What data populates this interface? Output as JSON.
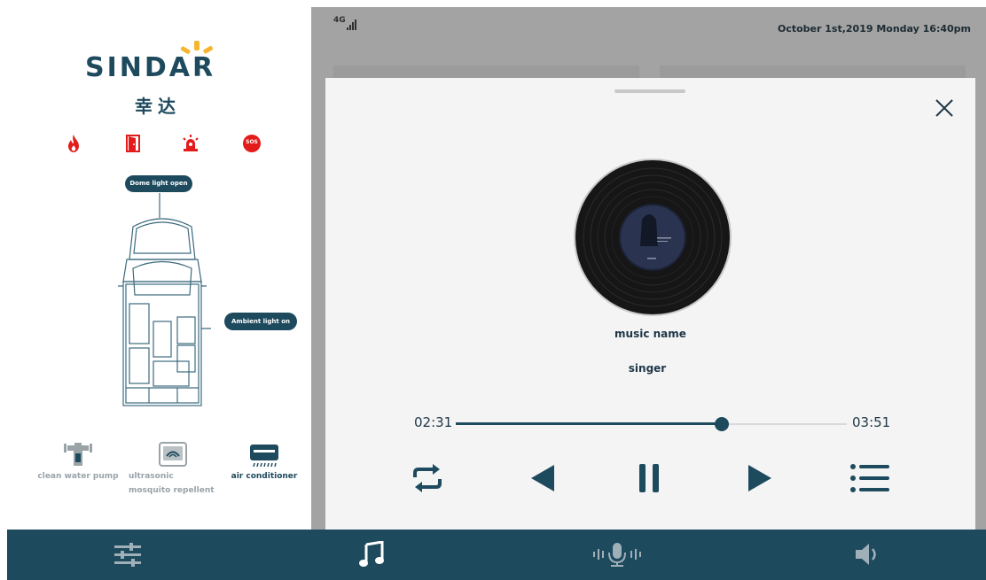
{
  "sidebar": {
    "logo": {
      "brand": "SINDAR",
      "brand_cn": "幸达"
    },
    "alerts": [
      {
        "name": "fire-alert",
        "icon": "fire-icon",
        "color": "#e31b1b"
      },
      {
        "name": "door-alert",
        "icon": "door-icon",
        "color": "#e31b1b"
      },
      {
        "name": "alarm-alert",
        "icon": "siren-icon",
        "color": "#e31b1b"
      },
      {
        "name": "sos-alert",
        "icon": "sos-icon",
        "label": "SOS",
        "color": "#e31b1b"
      }
    ],
    "vehicle": {
      "dome_light_label": "Dome light open",
      "ambient_light_label": "Ambient light on"
    },
    "devices": [
      {
        "label": "clean water pump",
        "icon": "water-pump-icon",
        "active": false
      },
      {
        "label": "ultrasonic  mosquito repellent",
        "icon": "mosquito-repellent-icon",
        "active": false
      },
      {
        "label": "air conditioner",
        "icon": "air-conditioner-icon",
        "active": true
      }
    ]
  },
  "status_bar": {
    "network": "4G",
    "datetime": "October 1st,2019 Monday 16:40pm"
  },
  "player": {
    "track_name": "music name",
    "singer": "singer",
    "elapsed": "02:31",
    "total": "03:51",
    "progress": 0.68,
    "controls": [
      {
        "name": "repeat-button",
        "icon": "repeat-icon"
      },
      {
        "name": "previous-button",
        "icon": "previous-icon"
      },
      {
        "name": "pause-button",
        "icon": "pause-icon"
      },
      {
        "name": "next-button",
        "icon": "next-icon"
      },
      {
        "name": "playlist-button",
        "icon": "playlist-icon"
      }
    ]
  },
  "bottom_nav": {
    "items": [
      {
        "name": "nav-settings",
        "icon": "sliders-icon",
        "active": false
      },
      {
        "name": "nav-music",
        "icon": "music-note-icon",
        "active": true
      },
      {
        "name": "nav-voice",
        "icon": "microphone-icon",
        "active": false
      },
      {
        "name": "nav-volume",
        "icon": "speaker-icon",
        "active": false
      }
    ]
  },
  "colors": {
    "primary": "#1e4a5e",
    "alert": "#e31b1b",
    "accent": "#f5b52e",
    "overlay": "#a3a3a3"
  }
}
